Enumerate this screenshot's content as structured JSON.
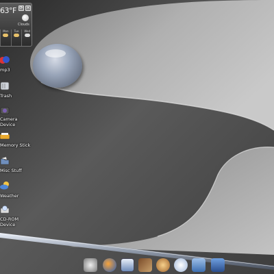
{
  "weather": {
    "temperature": "63°F",
    "condition": "Clouds",
    "forecast": [
      {
        "day": "Mon"
      },
      {
        "day": "Tue"
      },
      {
        "day": "Wed"
      }
    ]
  },
  "desktop_icons": [
    {
      "label": "mp3",
      "icon": "music-icon"
    },
    {
      "label": "Trash",
      "icon": "trash-icon"
    },
    {
      "label": "Camera\nDevice",
      "icon": "camera-icon"
    },
    {
      "label": "Memory Stick",
      "icon": "memory-stick-icon"
    },
    {
      "label": "Misc Stuff",
      "icon": "folder-icon"
    },
    {
      "label": "Weather",
      "icon": "weather-icon"
    },
    {
      "label": "CD-ROM\nDevice",
      "icon": "cdrom-icon"
    }
  ],
  "dock": {
    "items": [
      {
        "name": "settings-icon"
      },
      {
        "name": "browser-icon"
      },
      {
        "name": "mail-icon"
      },
      {
        "name": "text-editor-icon"
      },
      {
        "name": "chat-icon"
      },
      {
        "name": "cd-player-icon"
      },
      {
        "name": "file-manager-icon"
      },
      {
        "name": "clock-icon"
      }
    ]
  }
}
